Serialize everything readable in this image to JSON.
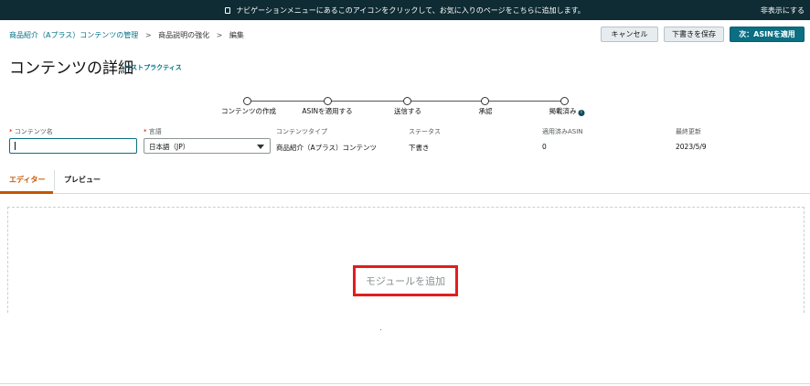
{
  "top_banner": {
    "message": "ナビゲーションメニューにあるこのアイコンをクリックして、お気に入りのページをこちらに追加します。",
    "hide_label": "非表示にする"
  },
  "breadcrumb": {
    "items": [
      "商品紹介（Aプラス）コンテンツの管理",
      "商品説明の強化",
      "編集"
    ],
    "separator": ">"
  },
  "actions": {
    "cancel": "キャンセル",
    "save_draft": "下書きを保存",
    "next": "次：ASINを適用"
  },
  "page": {
    "title": "コンテンツの詳細",
    "best_practices": "ベストプラクティス"
  },
  "stepper": {
    "steps": [
      "コンテンツの作成",
      "ASINを適用する",
      "送信する",
      "承認",
      "掲載済み"
    ],
    "info_glyph": "i"
  },
  "fields": {
    "required_mark": "*",
    "content_name": {
      "label": "コンテンツ名",
      "value": ""
    },
    "language": {
      "label": "言語",
      "value": "日本語（JP）"
    },
    "content_type": {
      "label": "コンテンツタイプ",
      "value": "商品紹介（Aプラス）コンテンツ"
    },
    "status": {
      "label": "ステータス",
      "value": "下書き"
    },
    "applied_asin": {
      "label": "適用済みASIN",
      "value": "0"
    },
    "last_updated": {
      "label": "最終更新",
      "value": "2023/5/9"
    }
  },
  "tabs": [
    {
      "label": "エディター",
      "active": true
    },
    {
      "label": "プレビュー",
      "active": false
    }
  ],
  "editor": {
    "add_module": "モジュールを追加"
  },
  "colors": {
    "banner_bg": "#0f2b33",
    "primary_button": "#0b6e83",
    "link": "#007185",
    "active_tab": "#c45500",
    "highlight_box": "#e01e1e"
  }
}
